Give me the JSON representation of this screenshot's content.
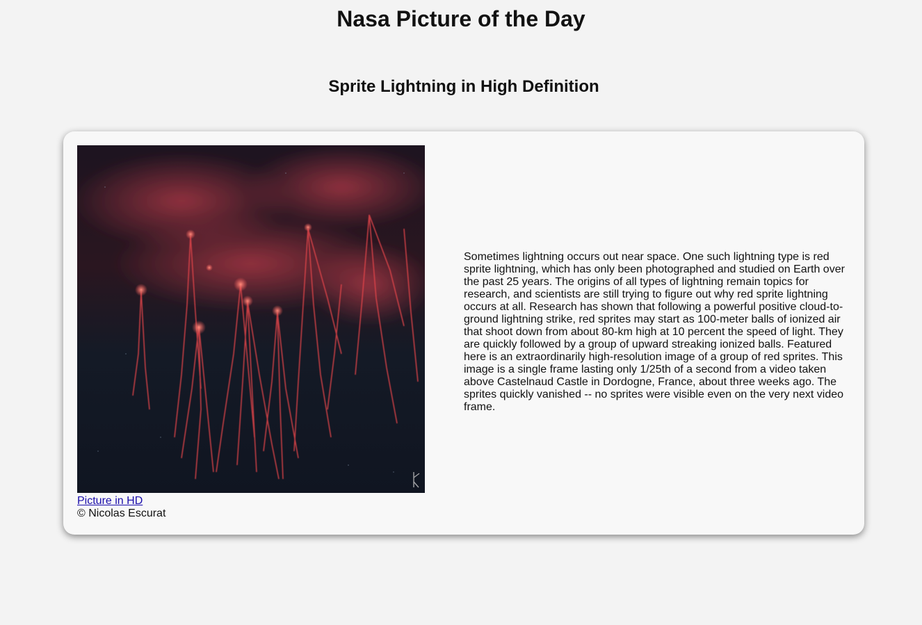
{
  "header": {
    "title": "Nasa Picture of the Day",
    "subtitle": "Sprite Lightning in High Definition"
  },
  "card": {
    "image_subject": "red sprite lightning photo",
    "hd_link_label": "Picture in HD",
    "credit": "© Nicolas Escurat",
    "description": "Sometimes lightning occurs out near space. One such lightning type is red sprite lightning, which has only been photographed and studied on Earth over the past 25 years. The origins of all types of lightning remain topics for research, and scientists are still trying to figure out why red sprite lightning occurs at all. Research has shown that following a powerful positive cloud-to-ground lightning strike, red sprites may start as 100-meter balls of ionized air that shoot down from about 80-km high at 10 percent the speed of light. They are quickly followed by a group of upward streaking ionized balls. Featured here is an extraordinarily high-resolution image of a group of red sprites. This image is a single frame lasting only 1/25th of a second from a video taken above Castelnaud Castle in Dordogne, France, about three weeks ago. The sprites quickly vanished -- no sprites were visible even on the very next video frame."
  },
  "colors": {
    "page_background": "#f3f3f3",
    "card_background": "#f8f8f8",
    "link": "#1a0dab",
    "sprite_red": "#e0444a",
    "sky_dark": "#121722"
  }
}
